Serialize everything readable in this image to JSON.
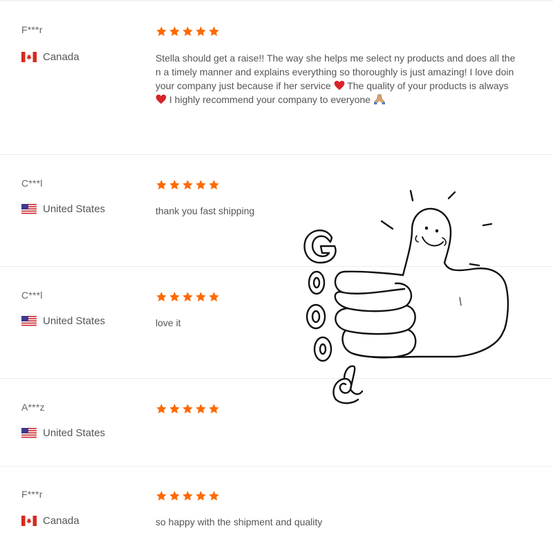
{
  "reviews": [
    {
      "reviewer": "F***r",
      "country": "Canada",
      "flag": "canada-flag-icon",
      "rating": 5,
      "text_lines": [
        "Stella should get a raise!! The way she helps me select ny products and does all the",
        "n a timely manner and explains everything so thoroughly is just amazing! I love doin",
        "your company just because if her service",
        "The quality of your products is always",
        "I highly recommend your company to everyone"
      ]
    },
    {
      "reviewer": "C***l",
      "country": "United States",
      "flag": "usa-flag-icon",
      "rating": 5,
      "text": "thank you fast shipping"
    },
    {
      "reviewer": "C***l",
      "country": "United States",
      "flag": "usa-flag-icon",
      "rating": 5,
      "text": "love it"
    },
    {
      "reviewer": "A***z",
      "country": "United States",
      "flag": "usa-flag-icon",
      "rating": 5,
      "text": ""
    },
    {
      "reviewer": "F***r",
      "country": "Canada",
      "flag": "canada-flag-icon",
      "rating": 5,
      "text": "so happy with the shipment and quality"
    }
  ],
  "colors": {
    "star": "#ff6a00",
    "text": "#555555",
    "name": "#666666",
    "divider": "#eeeeee"
  },
  "sticker": {
    "icon": "thumbs-up-icon",
    "lettering": "GOOOd"
  }
}
